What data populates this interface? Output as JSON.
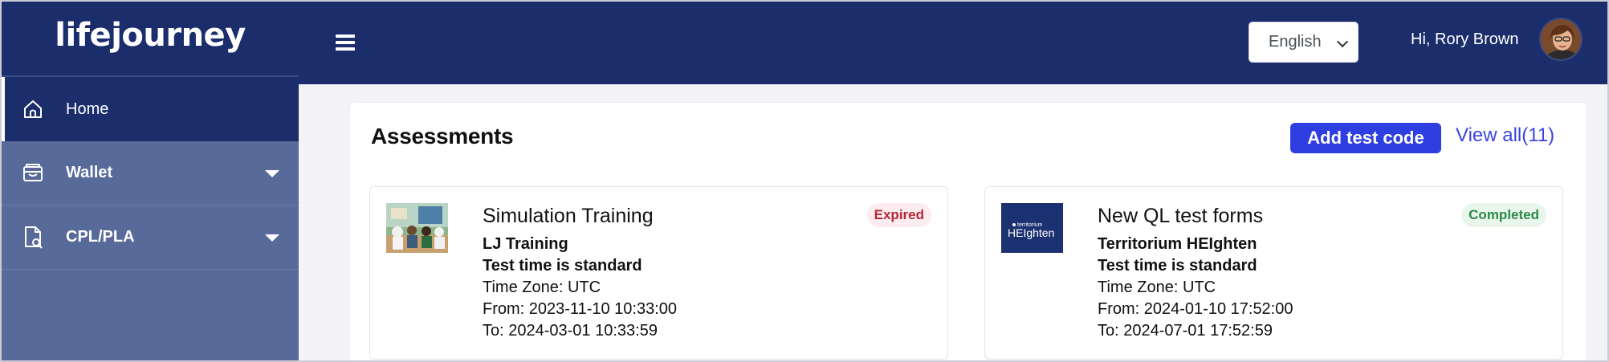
{
  "brand": {
    "name": "lifejourney"
  },
  "sidebar": {
    "items": [
      {
        "label": "Home",
        "icon": "home-icon",
        "active": true
      },
      {
        "label": "Wallet",
        "icon": "wallet-icon",
        "has_submenu": true
      },
      {
        "label": "CPL/PLA",
        "icon": "document-search-icon",
        "has_submenu": true
      }
    ]
  },
  "header": {
    "menu_icon": "hamburger-menu-icon",
    "language": {
      "selected": "English"
    },
    "greeting": "Hi, Rory Brown",
    "avatar_icon": "user-avatar"
  },
  "assessments": {
    "title": "Assessments",
    "add_button": "Add test code",
    "view_all": "View all(11)",
    "cards": [
      {
        "name": "Simulation Training",
        "org": "LJ Training",
        "test_time": "Test time is standard",
        "timezone": "Time Zone: UTC",
        "from": "From: 2023-11-10 10:33:00",
        "to": "To: 2024-03-01 10:33:59",
        "status": "Expired",
        "status_color": "#b52638"
      },
      {
        "name": "New QL test forms",
        "org": "Territorium HEIghten",
        "test_time": "Test time is standard",
        "timezone": "Time Zone: UTC",
        "from": "From: 2024-01-10 17:52:00",
        "to": "To: 2024-07-01 17:52:59",
        "status": "Completed",
        "status_color": "#2c8a45",
        "logo_text_top": "territorium",
        "logo_text_main": "HEIghten"
      }
    ]
  },
  "colors": {
    "nav_dark": "#1b2d6b",
    "sidebar": "#586a99",
    "primary_button": "#2f3ee0",
    "link": "#3b44e0"
  }
}
